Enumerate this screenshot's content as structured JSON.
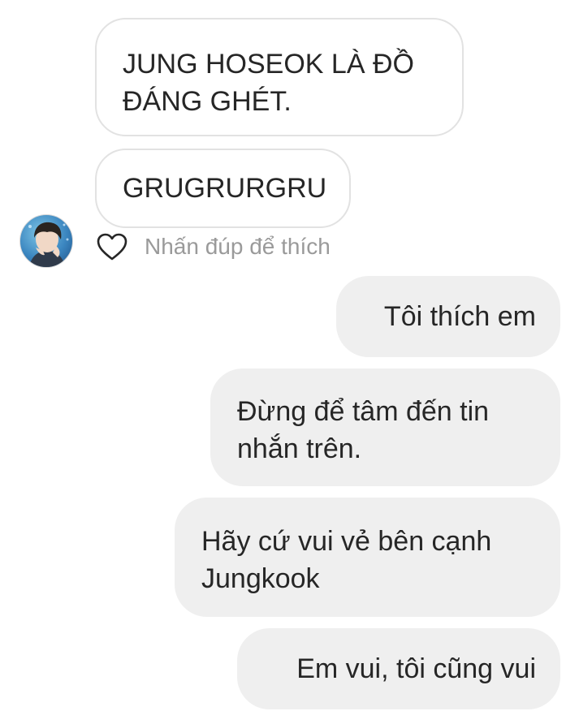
{
  "messages": {
    "incoming": [
      {
        "text": "JUNG HOSEOK LÀ ĐỒ\nĐÁNG GHÉT."
      },
      {
        "text": "GRUGRURGRU"
      }
    ],
    "outgoing": [
      {
        "text": "Tôi thích em"
      },
      {
        "text": "Đừng để tâm đến tin\nnhắn trên."
      },
      {
        "text": "Hãy cứ vui vẻ bên cạnh\nJungkook"
      },
      {
        "text": "Em vui, tôi cũng vui"
      }
    ]
  },
  "like_hint": "Nhấn đúp để thích",
  "colors": {
    "incoming_bubble_bg": "#ffffff",
    "incoming_bubble_border": "#e2e2e2",
    "outgoing_bubble_bg": "#efefef",
    "text": "#262626",
    "hint_text": "#9a9a9a"
  },
  "icons": {
    "like": "heart-outline-icon",
    "sender": "avatar"
  }
}
